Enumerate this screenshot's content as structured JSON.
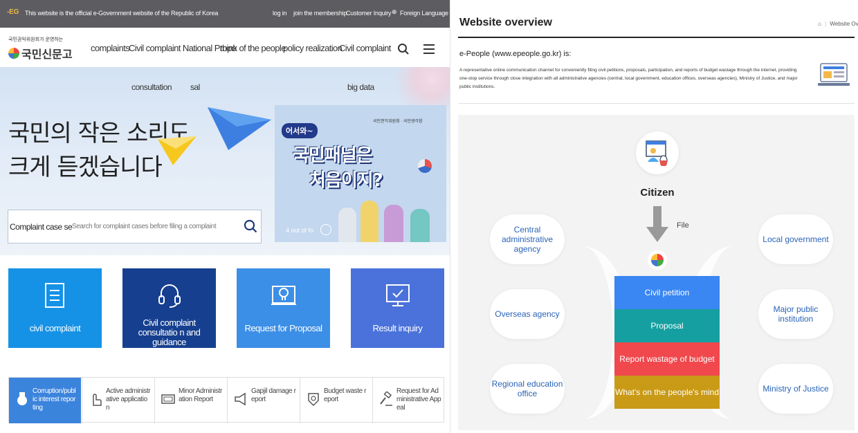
{
  "left": {
    "topbar": {
      "notice": "This website is the official e-Government website of the Republic of Korea",
      "links": [
        "log in",
        "join the membership",
        "Customer Inquiry",
        "Foreign Language"
      ]
    },
    "logo": {
      "sub": "국민권익위원회가 운영하는",
      "main": "국민신문고"
    },
    "nav_items": [
      "complaints",
      "Civil complaint National Propo",
      "think of the people",
      "policy realization",
      "Civil complaint"
    ],
    "subnav": [
      "consultation",
      "sal",
      "big data"
    ],
    "slogan": {
      "line1": "국민의 작은 소리도",
      "line2": "크게 듣겠습니다"
    },
    "search": {
      "label": "Complaint case se",
      "placeholder": "Search for complaint cases before filing a complaint"
    },
    "banner": {
      "badge": "어서와~",
      "line1": "국민패널은",
      "line2": "처음이지?",
      "org": "국민권익위원회 · 국민생각함",
      "pager": "4 out of fo"
    },
    "tiles": [
      {
        "label": "civil complaint",
        "color": "#1592e6",
        "icon": "document-icon"
      },
      {
        "label": "Civil complaint consultatio n and guidance",
        "color": "#16408f",
        "icon": "headset-icon"
      },
      {
        "label": "Request for Proposal",
        "color": "#3c8fe6",
        "icon": "lightbulb-icon"
      },
      {
        "label": "Result inquiry",
        "color": "#4a72da",
        "icon": "monitor-check-icon"
      }
    ],
    "strip": [
      {
        "label": "Corruption/publ ic interest repor ting",
        "icon": "medal-icon"
      },
      {
        "label": "Active administr ative applicatio n",
        "icon": "hand-pointer-icon"
      },
      {
        "label": "Minor Administr ation Report",
        "icon": "screen-icon"
      },
      {
        "label": "Gapjil damage r eport",
        "icon": "megaphone-icon"
      },
      {
        "label": "Budget waste r eport",
        "icon": "badge-icon"
      },
      {
        "label": "Request for Ad ministrative App eal",
        "icon": "gavel-icon"
      }
    ]
  },
  "right": {
    "title": "Website overview",
    "breadcrumb": "Website Overview",
    "heading": "e-People (www.epeople.go.kr) is:",
    "description": "A representative online communication channel for conveniently filing civil petitions, proposals, participation, and reports of budget wastage through the internet, providing one-stop service through close integration with all administrative agencies (central, local government, education offices, overseas agencies), Ministry of Justice, and major public institutions.",
    "diagram": {
      "center_label": "Citizen",
      "arrow_label": "File",
      "left_nodes": [
        "Central administrative agency",
        "Overseas agency",
        "Regional education office"
      ],
      "right_nodes": [
        "Local government",
        "Major public institution",
        "Ministry of Justice"
      ],
      "stack": [
        {
          "label": "Civil petition",
          "color": "#3a86f2"
        },
        {
          "label": "Proposal",
          "color": "#169fa0"
        },
        {
          "label": "Report wastage of budget",
          "color": "#f0484d"
        },
        {
          "label": "What's on the people's mind",
          "color": "#c99a16"
        }
      ]
    }
  }
}
